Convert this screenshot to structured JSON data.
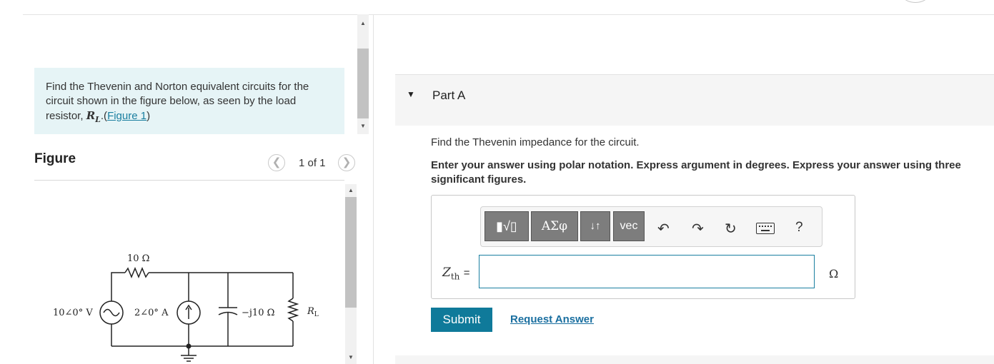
{
  "problem": {
    "text_before": "Find the Thevenin and Norton equivalent circuits for the circuit shown in the figure below, as seen by the load resistor, ",
    "load_symbol": "R",
    "load_subscript": "L",
    "link_prefix": ".(",
    "figure_link": "Figure 1",
    "link_suffix": ")"
  },
  "figure": {
    "title": "Figure",
    "prev_icon": "chevron-left-icon",
    "next_icon": "chevron-right-icon",
    "counter": "1 of 1",
    "circuit_labels": {
      "resistor": "10 Ω",
      "voltage_source": "10∠0° V",
      "current_source": "2∠0° A",
      "capacitor": "−j10 Ω",
      "load": "R",
      "load_sub": "L"
    }
  },
  "part": {
    "toggle_icon": "triangle-down-icon",
    "title": "Part A",
    "question": "Find the Thevenin impedance for the circuit.",
    "instructions": "Enter your answer using polar notation. Express argument in degrees. Express your answer using three significant figures."
  },
  "toolbar": {
    "buttons": [
      {
        "name": "templates",
        "label": "▮√▯"
      },
      {
        "name": "greek",
        "label": "ΑΣφ"
      },
      {
        "name": "arrows",
        "label": "↓↑"
      },
      {
        "name": "vec",
        "label": "vec"
      }
    ],
    "icons": [
      "undo-icon",
      "redo-icon",
      "reset-icon",
      "keyboard-icon",
      "help-icon"
    ],
    "help_label": "?"
  },
  "answer": {
    "label_symbol": "Z",
    "label_subscript": "th",
    "label_equals": "=",
    "value": "",
    "unit": "Ω"
  },
  "actions": {
    "submit_label": "Submit",
    "request_label": "Request Answer"
  },
  "colors": {
    "accent": "#0f7a9a",
    "link": "#1a7fa0",
    "problem_bg": "#e6f4f6",
    "toolbar_button": "#7d7d7d"
  }
}
